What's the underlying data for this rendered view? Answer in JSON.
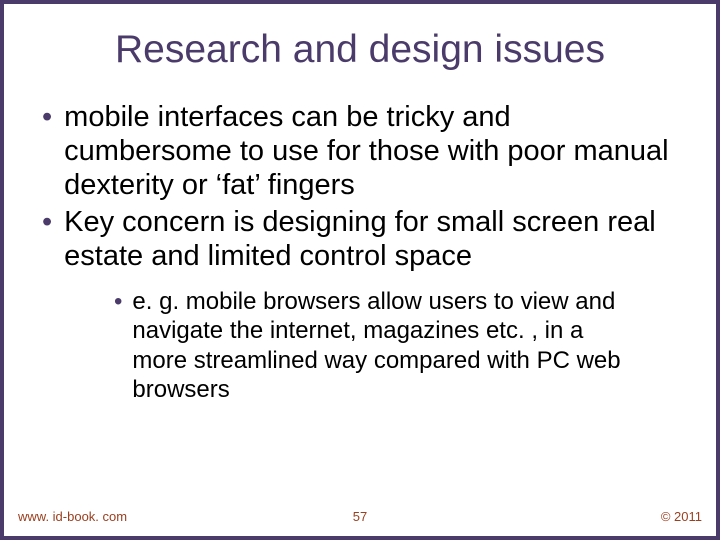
{
  "title": "Research and design issues",
  "bullets": {
    "l1_1": "mobile interfaces can be tricky and cumbersome to use for those with poor manual dexterity or ‘fat’ fingers",
    "l1_2": "Key concern is designing for small screen real estate and limited control space",
    "l2_1": "e. g. mobile browsers allow users to view and navigate the internet, magazines etc. , in a more streamlined way compared with PC web browsers"
  },
  "footer": {
    "left": "www. id-book. com",
    "center": "57",
    "right": "© 2011"
  },
  "colors": {
    "border": "#4a3b6a",
    "title": "#4a3b6a",
    "bullet_dot": "#4a3b6a",
    "footer_text": "#9a3f1f"
  }
}
